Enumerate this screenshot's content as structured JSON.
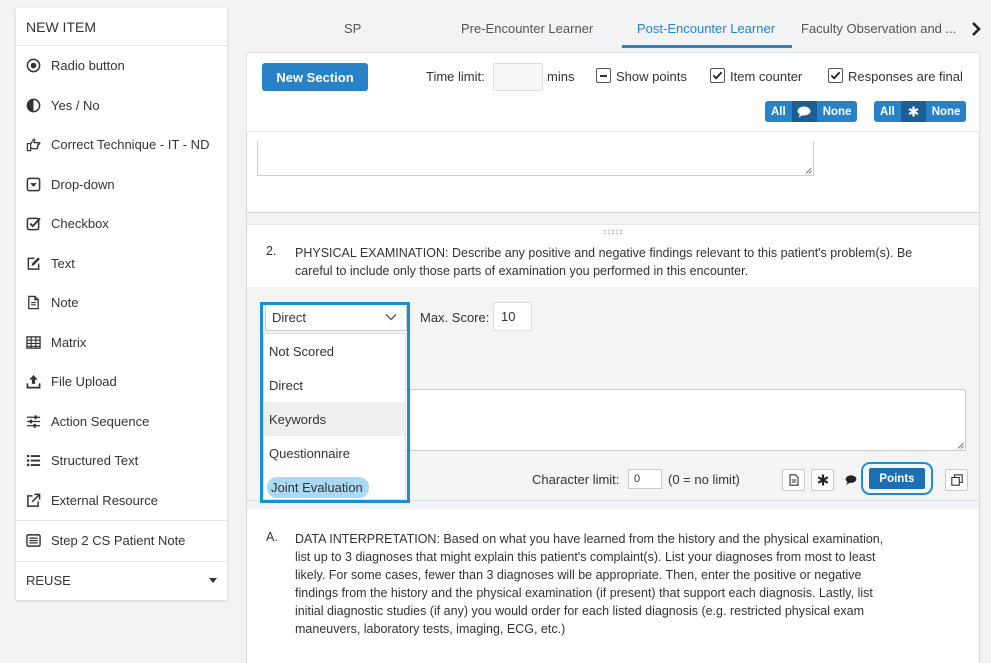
{
  "sidebar": {
    "header": "NEW ITEM",
    "items": [
      {
        "label": "Radio button",
        "icon": "radio-icon"
      },
      {
        "label": "Yes / No",
        "icon": "half-circle-icon"
      },
      {
        "label": "Correct Technique - IT - ND",
        "icon": "thumb-pointer-icon"
      },
      {
        "label": "Drop-down",
        "icon": "dropdown-box-icon"
      },
      {
        "label": "Checkbox",
        "icon": "checkbox-icon"
      },
      {
        "label": "Text",
        "icon": "edit-icon"
      },
      {
        "label": "Note",
        "icon": "file-icon"
      },
      {
        "label": "Matrix",
        "icon": "table-icon"
      },
      {
        "label": "File Upload",
        "icon": "upload-icon"
      },
      {
        "label": "Action Sequence",
        "icon": "sliders-icon"
      },
      {
        "label": "Structured Text",
        "icon": "list-icon"
      },
      {
        "label": "External Resource",
        "icon": "external-link-icon"
      }
    ],
    "extra_item": {
      "label": "Step 2 CS Patient Note",
      "icon": "card-list-icon"
    },
    "footer": "REUSE"
  },
  "tabs": [
    {
      "label": "SP",
      "active": false
    },
    {
      "label": "Pre-Encounter Learner",
      "active": false
    },
    {
      "label": "Post-Encounter Learner",
      "active": true
    },
    {
      "label": "Faculty Observation and ...",
      "active": false
    }
  ],
  "toolbar": {
    "new_section": "New Section",
    "time_limit_label": "Time limit:",
    "time_limit_value": "",
    "mins_label": "mins",
    "show_points": {
      "label": "Show points",
      "state": "indeterminate"
    },
    "item_counter": {
      "label": "Item counter",
      "checked": true
    },
    "responses_final": {
      "label": "Responses are final",
      "checked": true
    },
    "comment_toggle": {
      "all": "All",
      "none": "None",
      "icon": "comment-icon"
    },
    "required_toggle": {
      "all": "All",
      "none": "None",
      "icon": "asterisk-icon"
    }
  },
  "question": {
    "number": "2.",
    "text": "PHYSICAL EXAMINATION: Describe any positive and negative findings relevant to this patient's problem(s). Be careful to include only those parts of examination you performed in this encounter.",
    "scoring_type": "Direct",
    "max_score_label": "Max. Score:",
    "max_score": "10",
    "char_limit_label": "Character limit:",
    "char_limit": "0",
    "char_limit_note": "(0 = no limit)",
    "points_button": "Points"
  },
  "dropdown_options": [
    {
      "label": "Not Scored",
      "state": "normal"
    },
    {
      "label": "Direct",
      "state": "normal"
    },
    {
      "label": "Keywords",
      "state": "hover"
    },
    {
      "label": "Questionnaire",
      "state": "normal"
    },
    {
      "label": "Joint Evaluation",
      "state": "highlighted"
    }
  ],
  "next_question": {
    "letter": "A.",
    "text": "DATA INTERPRETATION: Based on what you have learned from the history and the physical examination, list up to 3 diagnoses that might explain this patient's complaint(s). List your diagnoses from most to least likely. For some cases, fewer than 3 diagnoses will be appropriate. Then, enter the positive or negative findings from the history and the physical examination (if present) that support each diagnosis. Lastly, list initial diagnostic studies (if any) you would order for each listed diagnosis (e.g. restricted physical exam maneuvers, laboratory tests, imaging, ECG, etc.)"
  },
  "colors": {
    "accent": "#2a82c6",
    "accent_dark": "#1b5f94",
    "focus_ring": "#1b8fd6",
    "highlight_pill": "#a9d9f5"
  }
}
